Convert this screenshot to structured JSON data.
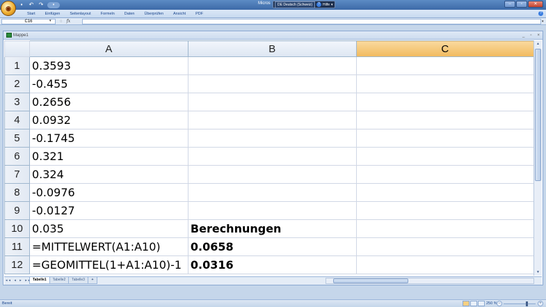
{
  "window": {
    "title_app": "Micros",
    "language": "DE Deutsch (Schweiz)",
    "help_label": "Hilfe"
  },
  "ribbon": {
    "tabs": [
      "Start",
      "Einfügen",
      "Seitenlayout",
      "Formeln",
      "Daten",
      "Überprüfen",
      "Ansicht",
      "PDF"
    ]
  },
  "formula_bar": {
    "name_box": "C16",
    "fx_label": "fx",
    "formula": ""
  },
  "workbook": {
    "name": "Mappe1"
  },
  "sheet": {
    "columns": [
      "A",
      "B",
      "C"
    ],
    "selected_column": "C",
    "rows": [
      {
        "num": "1",
        "A": "0.3593",
        "B": "",
        "C": ""
      },
      {
        "num": "2",
        "A": "-0.455",
        "B": "",
        "C": ""
      },
      {
        "num": "3",
        "A": "0.2656",
        "B": "",
        "C": ""
      },
      {
        "num": "4",
        "A": "0.0932",
        "B": "",
        "C": ""
      },
      {
        "num": "5",
        "A": "-0.1745",
        "B": "",
        "C": ""
      },
      {
        "num": "6",
        "A": "0.321",
        "B": "",
        "C": ""
      },
      {
        "num": "7",
        "A": "0.324",
        "B": "",
        "C": ""
      },
      {
        "num": "8",
        "A": "-0.0976",
        "B": "",
        "C": ""
      },
      {
        "num": "9",
        "A": "-0.0127",
        "B": "",
        "C": ""
      },
      {
        "num": "10",
        "A": "0.035",
        "B": "Berechnungen",
        "C": ""
      },
      {
        "num": "11",
        "A": "=MITTELWERT(A1:A10)",
        "B": "0.0658",
        "C": ""
      },
      {
        "num": "12",
        "A": "=GEOMITTEL(1+A1:A10)-1",
        "B": "0.0316",
        "C": ""
      }
    ],
    "bold_b_rows": [
      "10",
      "11",
      "12"
    ]
  },
  "sheet_tabs": [
    "Tabelle1",
    "Tabelle2",
    "Tabelle3"
  ],
  "active_sheet": "Tabelle1",
  "status": {
    "text": "Bereit",
    "zoom": "250 %"
  }
}
